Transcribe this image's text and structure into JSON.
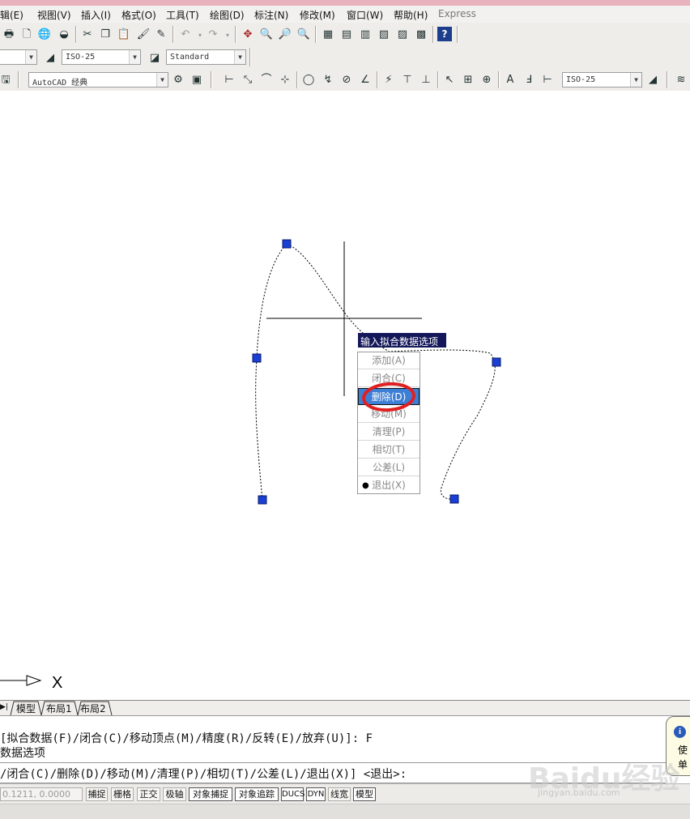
{
  "menubar": {
    "items": [
      "编辑(E)",
      "视图(V)",
      "插入(I)",
      "格式(O)",
      "工具(T)",
      "绘图(D)",
      "标注(N)",
      "修改(M)",
      "窗口(W)",
      "帮助(H)",
      "Express"
    ],
    "first_visible": "辑(E)"
  },
  "toolbar2": {
    "dimstyle_value": "ISO-25",
    "textstyle_value": "Standard"
  },
  "toolbar3": {
    "workspace_value": "AutoCAD 经典",
    "dimstyle2_value": "ISO-25"
  },
  "context_menu": {
    "title": "输入拟合数据选项",
    "items": [
      "添加(A)",
      "闭合(C)",
      "删除(D)",
      "移动(M)",
      "清理(P)",
      "相切(T)",
      "公差(L)",
      "退出(X)"
    ],
    "selected": "删除(D)",
    "current_default": "退出(X)",
    "bullet": "●"
  },
  "highlight_color": "#e02020",
  "tabs": {
    "nav": "▶|",
    "model": "模型",
    "layout1": "布局1",
    "layout2": "布局2"
  },
  "command": {
    "line1": " [拟合数据(F)/闭合(C)/移动顶点(M)/精度(R)/反转(E)/放弃(U)]: F",
    "line2": "数据选项",
    "prompt": "/闭合(C)/删除(D)/移动(M)/清理(P)/相切(T)/公差(L)/退出(X)] <退出>:"
  },
  "bubble": {
    "line1": "使",
    "line2": "单"
  },
  "statusbar": {
    "coords": "0.1211, 0.0000",
    "buttons": [
      "捕捉",
      "栅格",
      "正交",
      "极轴",
      "对象捕捉",
      "对象追踪",
      "DUCS",
      "DYN",
      "线宽",
      "模型"
    ]
  },
  "ucs": {
    "x_label": "X"
  },
  "watermark": {
    "text": "Baidu经验",
    "url": "jingyan.baidu.com"
  }
}
